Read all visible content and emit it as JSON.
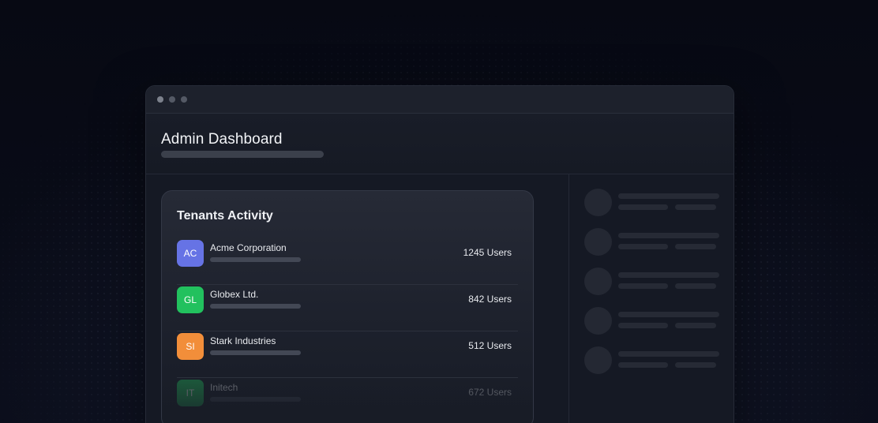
{
  "header": {
    "title": "Admin Dashboard"
  },
  "card": {
    "title": "Tenants Activity",
    "rows": [
      {
        "initials": "AC",
        "name": "Acme Corporation",
        "users": "1245 Users",
        "color": "#6673e5"
      },
      {
        "initials": "GL",
        "name": "Globex Ltd.",
        "users": "842 Users",
        "color": "#22c15e"
      },
      {
        "initials": "SI",
        "name": "Stark Industries",
        "users": "512 Users",
        "color": "#f28e3a"
      },
      {
        "initials": "IT",
        "name": "Initech",
        "users": "672 Users",
        "color": "#22c15e"
      }
    ]
  },
  "colors": {
    "background": "#080b17",
    "window": "#151924",
    "accent_indigo": "#6673e5",
    "accent_green": "#22c15e",
    "accent_orange": "#f28e3a"
  }
}
